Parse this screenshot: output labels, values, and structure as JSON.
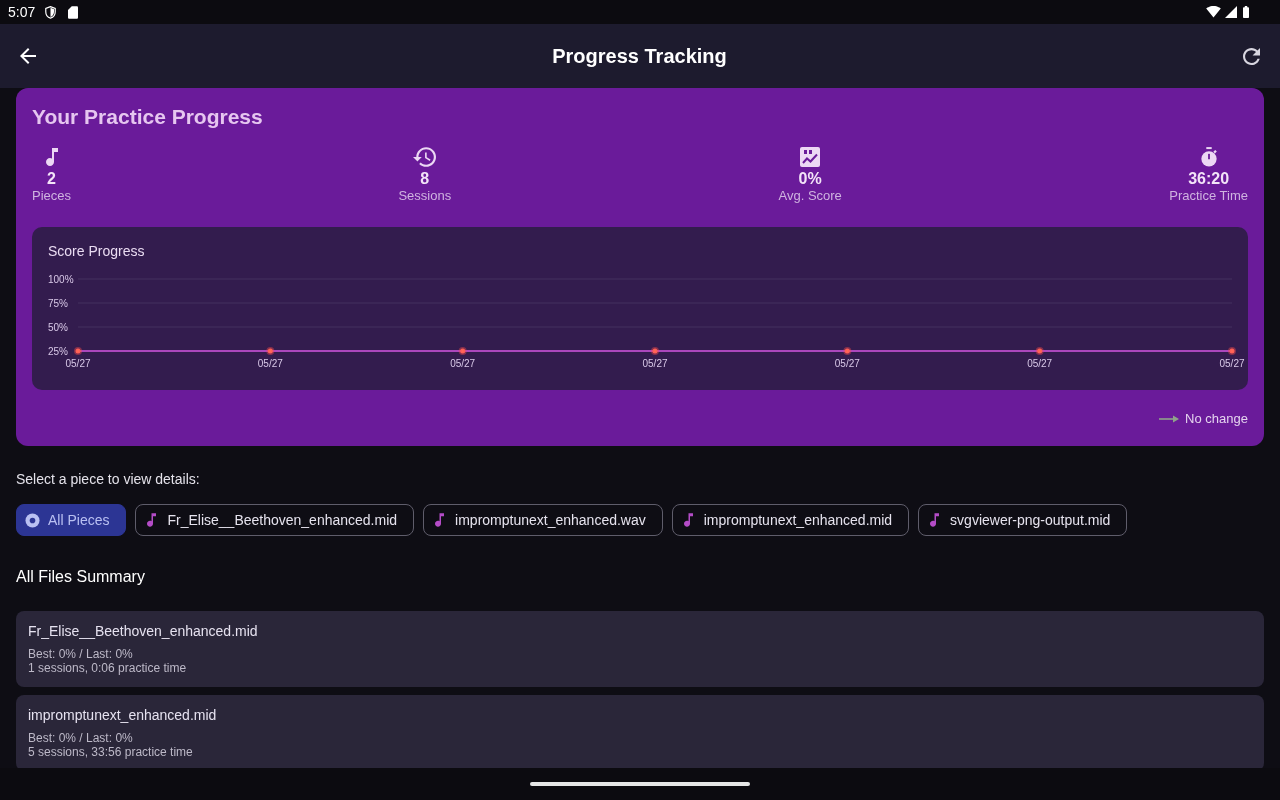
{
  "status_bar": {
    "time": "5:07"
  },
  "app_bar": {
    "title": "Progress Tracking"
  },
  "progress_card": {
    "title": "Your Practice Progress",
    "stats": [
      {
        "kind": "pieces",
        "value": "2",
        "label": "Pieces"
      },
      {
        "kind": "sessions",
        "value": "8",
        "label": "Sessions"
      },
      {
        "kind": "score",
        "value": "0%",
        "label": "Avg. Score"
      },
      {
        "kind": "time",
        "value": "36:20",
        "label": "Practice Time"
      }
    ],
    "chart": {
      "chart_data": [
        {
          "type": "line",
          "title": "Score Progress",
          "categories": [
            "05/27",
            "05/27",
            "05/27",
            "05/27",
            "05/27",
            "05/27",
            "05/27"
          ],
          "values": [
            25,
            25,
            25,
            25,
            25,
            25,
            25
          ],
          "yticks": [
            {
              "value": 25,
              "label": "25%"
            },
            {
              "value": 50,
              "label": "50%"
            },
            {
              "value": 75,
              "label": "75%"
            },
            {
              "value": 100,
              "label": "100%"
            }
          ],
          "ylim": [
            25,
            100
          ],
          "color": "#ab47bc",
          "marker": "circle",
          "grid": true
        }
      ]
    },
    "trend": {
      "kind": "flat",
      "label": "No change"
    }
  },
  "piece_selector": {
    "prompt": "Select a piece to view details:",
    "chips": [
      {
        "kind": "all",
        "label": "All Pieces",
        "selected": true
      },
      {
        "kind": "file",
        "label": "Fr_Elise__Beethoven_enhanced.mid",
        "selected": false
      },
      {
        "kind": "file",
        "label": "impromptunext_enhanced.wav",
        "selected": false
      },
      {
        "kind": "file",
        "label": "impromptunext_enhanced.mid",
        "selected": false
      },
      {
        "kind": "file",
        "label": "svgviewer-png-output.mid",
        "selected": false
      }
    ]
  },
  "summary": {
    "title": "All Files Summary",
    "files": [
      {
        "name": "Fr_Elise__Beethoven_enhanced.mid",
        "scores": "Best: 0% / Last: 0%",
        "usage": "1 sessions, 0:06 practice time"
      },
      {
        "name": "impromptunext_enhanced.mid",
        "scores": "Best: 0% / Last: 0%",
        "usage": "5 sessions, 33:56 practice time"
      }
    ]
  }
}
